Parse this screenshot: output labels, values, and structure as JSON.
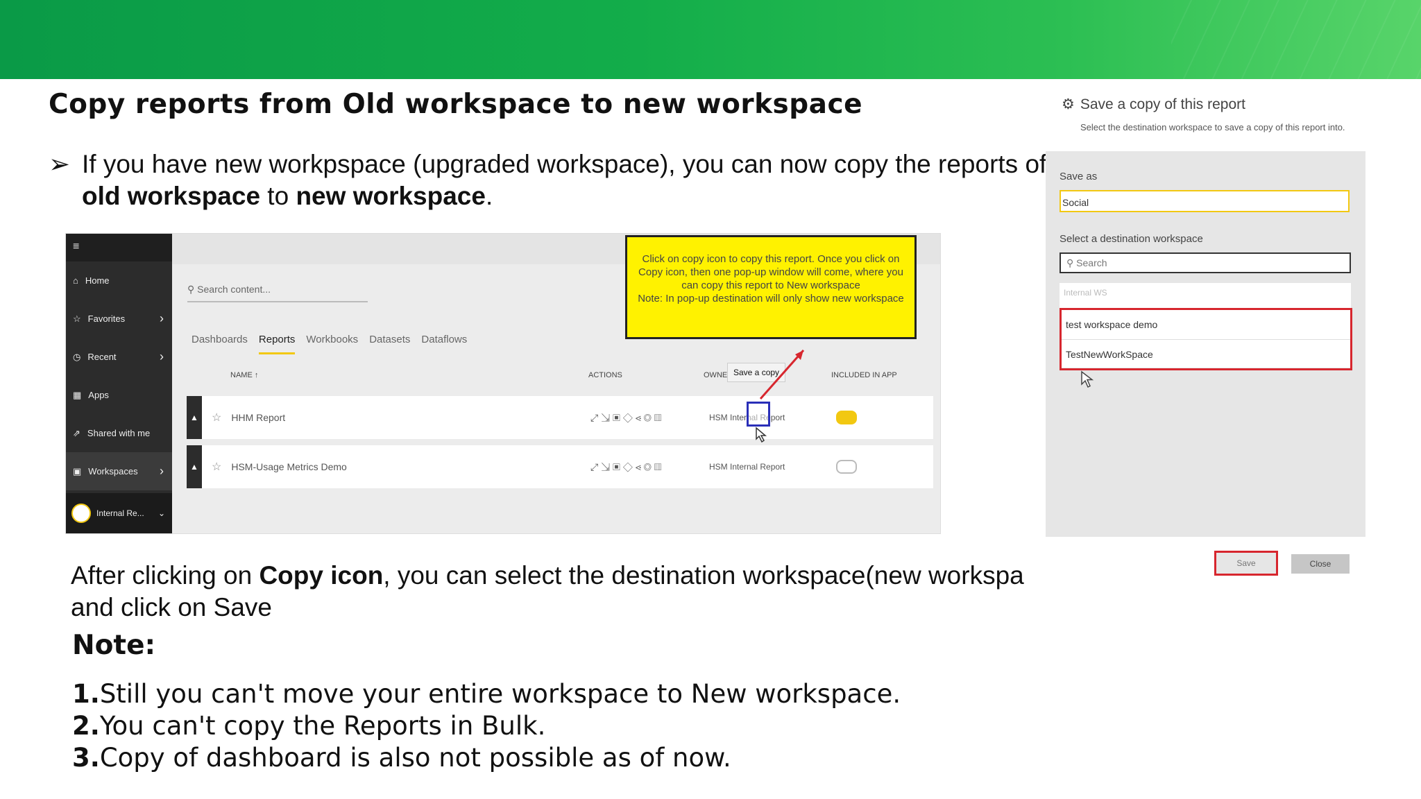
{
  "slide": {
    "title": "Copy reports from Old workspace to new workspace",
    "bullet": {
      "marker": "➢",
      "t1": "If you have new workpspace (upgraded workspace), you can now copy the reports of ",
      "b1": "old workspace",
      "t2": " to ",
      "b2": "new workspace",
      "t3": "."
    },
    "after": {
      "t1": "After clicking on ",
      "b1": "Copy icon",
      "t2": ", you can select the destination workspace(new workspa",
      "t3": "and click on Save"
    },
    "note_label": "Note:",
    "points": [
      {
        "num": "1.",
        "text": "Still you can't move your entire workspace to New workspace."
      },
      {
        "num": "2.",
        "text": "You can't copy the Reports in Bulk."
      },
      {
        "num": "3.",
        "text": "Copy of dashboard is also not possible as of now."
      }
    ]
  },
  "screenshot1": {
    "nav": [
      {
        "icon": "⌂",
        "label": "Home",
        "chevron": ""
      },
      {
        "icon": "☆",
        "label": "Favorites",
        "chevron": "›"
      },
      {
        "icon": "◷",
        "label": "Recent",
        "chevron": "›"
      },
      {
        "icon": "▦",
        "label": "Apps",
        "chevron": ""
      },
      {
        "icon": "⇗",
        "label": "Shared with me",
        "chevron": ""
      },
      {
        "icon": "▣",
        "label": "Workspaces",
        "chevron": "›"
      }
    ],
    "workspace": "Internal Re...",
    "search_placeholder": "Search content...",
    "tabs": [
      "Dashboards",
      "Reports",
      "Workbooks",
      "Datasets",
      "Dataflows"
    ],
    "col_name": "NAME ↑",
    "col_actions": "ACTIONS",
    "col_owner": "OWNER",
    "col_included": "INCLUDED IN APP",
    "tooltip": "Save a copy",
    "rows": [
      {
        "name": "HHM Report",
        "owner": "HSM Internal Report",
        "included": true
      },
      {
        "name": "HSM-Usage Metrics Demo",
        "owner": "HSM Internal Report",
        "included": false
      }
    ],
    "callout": "Click on copy icon to copy this report. Once you click on Copy icon, then one pop-up window will come, where you can copy this report to New workspace",
    "callout_note": "Note: In pop-up destination will only show new workspace"
  },
  "dialog": {
    "title": "Save a copy of this report",
    "subtitle": "Select the destination workspace to save a copy of this report into.",
    "save_as_label": "Save as",
    "save_as_value": "Social",
    "dest_label": "Select a destination workspace",
    "search_placeholder": "Search",
    "blurred_item": "Internal WS",
    "options": [
      "test workspace demo",
      "TestNewWorkSpace"
    ],
    "save_button": "Save",
    "close_button": "Close"
  },
  "colors": {
    "banner": "#13ad4a",
    "highlight_red": "#d7262e",
    "callout_yellow": "#fff200",
    "accent_yellow": "#f2c811"
  }
}
